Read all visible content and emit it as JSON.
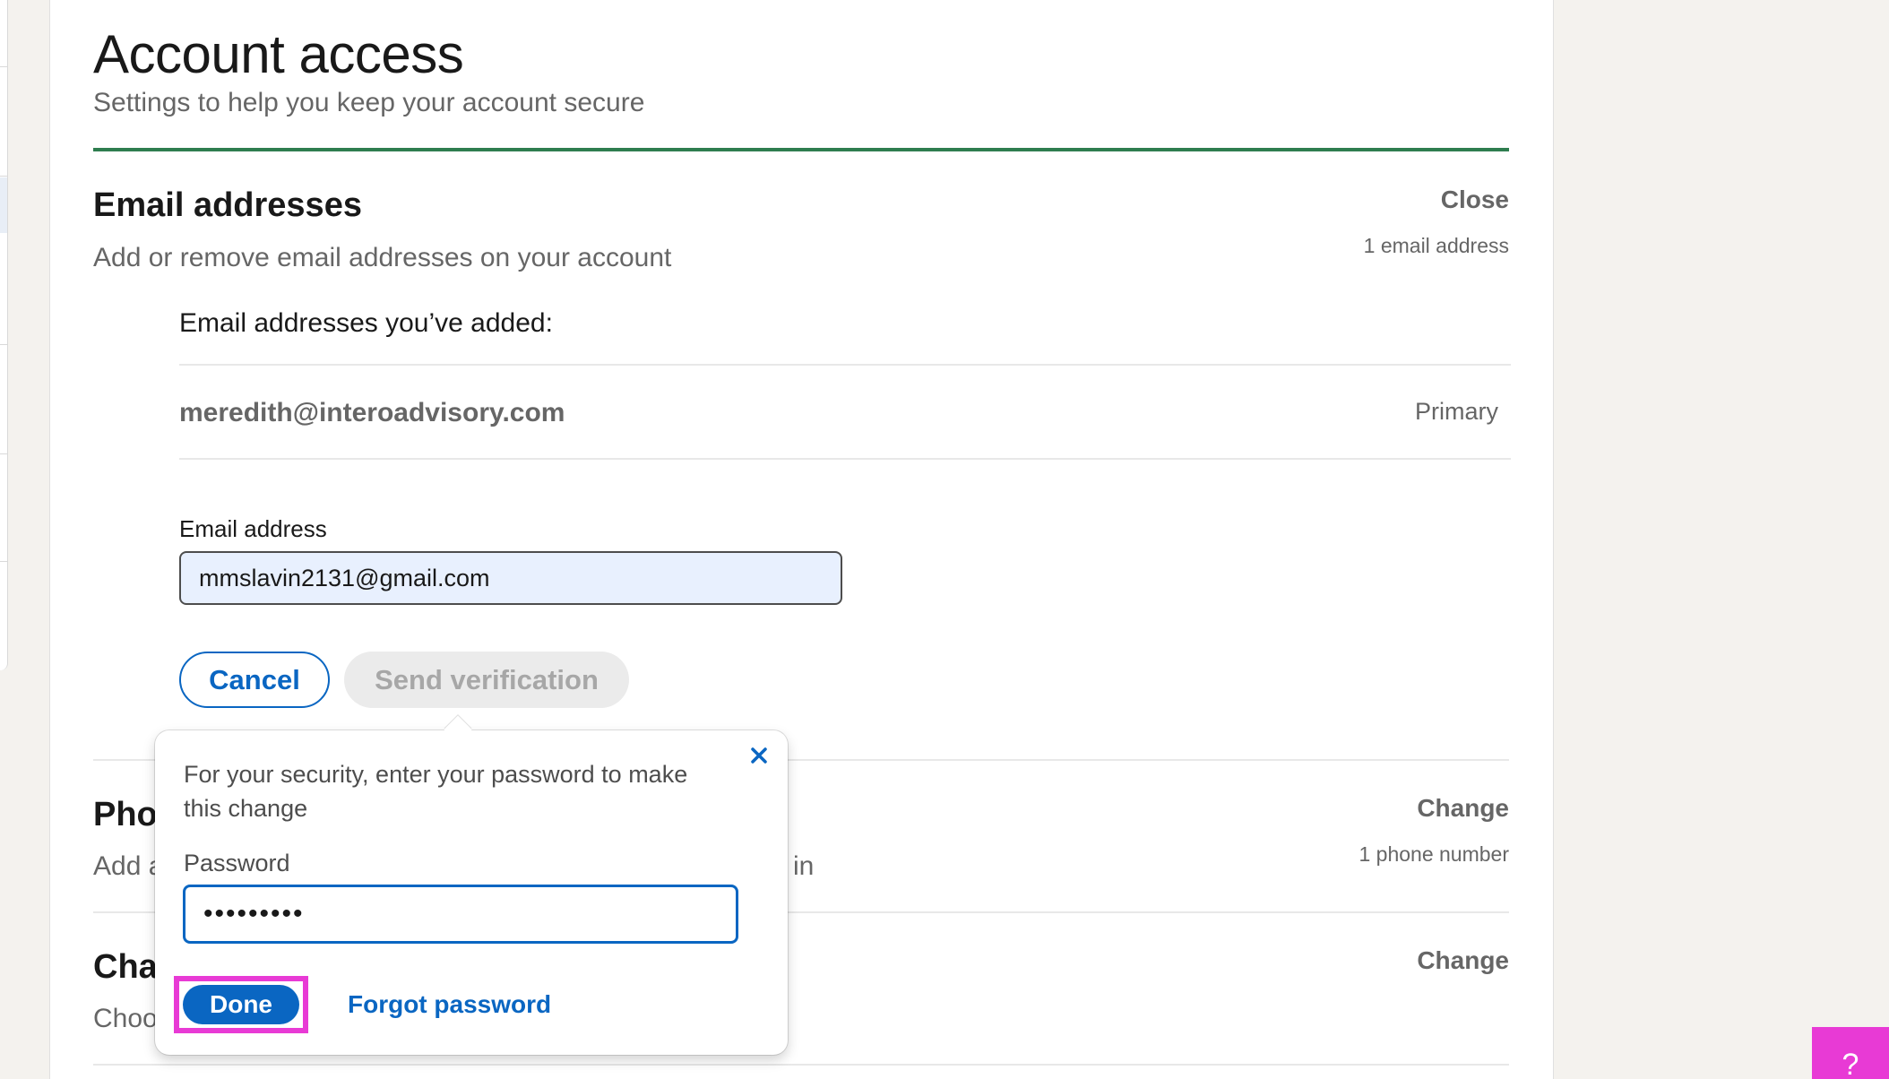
{
  "page": {
    "title": "Account access",
    "subtitle": "Settings to help you keep your account secure"
  },
  "email_section": {
    "title": "Email addresses",
    "description": "Add or remove email addresses on your account",
    "action": "Close",
    "count": "1 email address",
    "added_label": "Email addresses you’ve added:",
    "emails": [
      {
        "address": "meredith@interoadvisory.com",
        "tag": "Primary"
      }
    ],
    "new_email_label": "Email address",
    "new_email_value": "mmslavin2131@gmail.com",
    "cancel_label": "Cancel",
    "send_label": "Send verification"
  },
  "phone_section": {
    "title_visible": "Pho",
    "desc_visible_start": "Add a",
    "desc_visible_end": "in",
    "action": "Change",
    "count": "1 phone number"
  },
  "third_section": {
    "title_visible": "Cha",
    "desc_visible": "Choo",
    "action": "Change"
  },
  "popover": {
    "message": "For your security, enter your password to make this change",
    "password_label": "Password",
    "password_value": "•••••••••",
    "done_label": "Done",
    "forgot_label": "Forgot password"
  },
  "help_badge": {
    "label": "?"
  },
  "colors": {
    "accent_green": "#2e7d4f",
    "link_blue": "#0a66c2",
    "highlight_magenta": "#e83ad5"
  }
}
